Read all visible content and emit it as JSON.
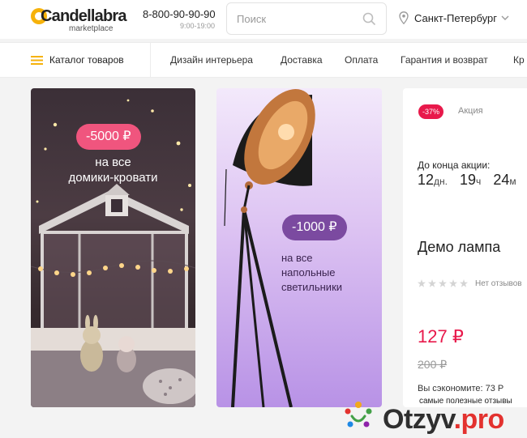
{
  "header": {
    "logo_name": "Candellabra",
    "logo_sub": "marketplace",
    "phone": "8-800-90-90-90",
    "hours": "9:00-19:00",
    "search_placeholder": "Поиск",
    "city": "Санкт-Петербург"
  },
  "nav": {
    "catalog": "Каталог товаров",
    "items": [
      "Дизайн интерьера",
      "Доставка",
      "Оплата",
      "Гарантия и возврат",
      "Кр"
    ]
  },
  "banners": [
    {
      "badge": "-5000 ₽",
      "line1": "на все",
      "line2": "домики-кровати"
    },
    {
      "badge": "-1000 ₽",
      "line1": "на все",
      "line2": "напольные",
      "line3": "светильники"
    }
  ],
  "product": {
    "discount": "-37%",
    "promo": "Акция",
    "until": "До конца акции:",
    "days": "12",
    "days_unit": "дн.",
    "hours": "19",
    "hours_unit": "ч",
    "minutes": "24",
    "minutes_unit": "м",
    "name": "Демо лампа",
    "rating": 0,
    "reviews": "Нет отзывов",
    "price": "127 ₽",
    "old_price": "200 ₽",
    "save": "Вы сэкономите: 73 Р"
  },
  "watermark": {
    "slogan": "самые полезные отзывы",
    "name": "Otzyv",
    "suffix": ".pro"
  },
  "colors": {
    "accent": "#e8194b",
    "logo": "#f6b20b",
    "badge_pink": "#f0557e",
    "badge_purple": "#7b4aa0"
  }
}
